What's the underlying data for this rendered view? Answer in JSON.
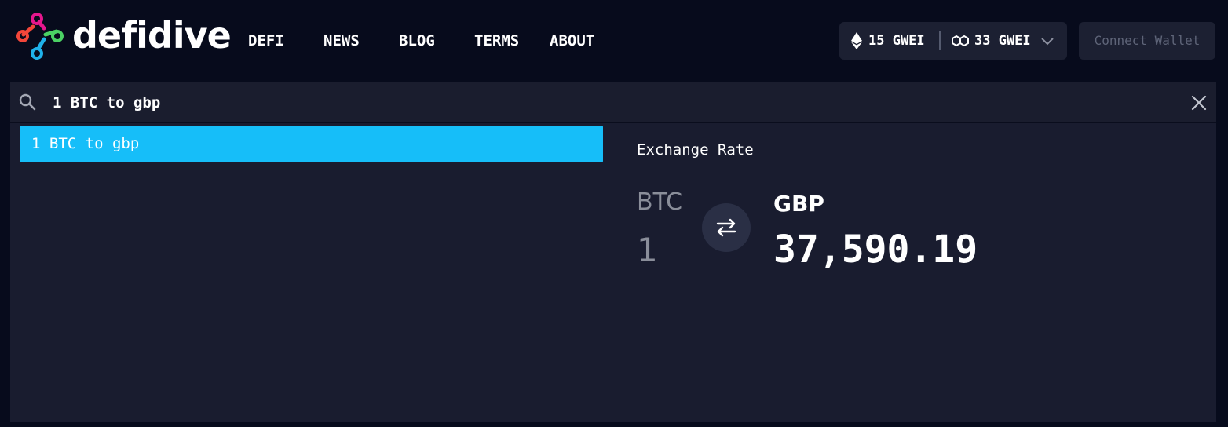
{
  "brand": {
    "name": "defidive"
  },
  "nav": {
    "items": [
      "DEFI",
      "NEWS",
      "BLOG",
      "TERMS",
      "ABOUT"
    ]
  },
  "gas": {
    "eth": "15 GWEI",
    "polygon": "33 GWEI"
  },
  "wallet": {
    "connect_label": "Connect Wallet"
  },
  "search": {
    "value": "1 BTC to gbp"
  },
  "results": [
    {
      "label": "1 BTC to gbp"
    }
  ],
  "exchange": {
    "title": "Exchange Rate",
    "from_code": "BTC",
    "from_amount": "1",
    "to_code": "GBP",
    "to_amount": "37,590.19"
  },
  "colors": {
    "background": "#070b1c",
    "panel": "#191c2f",
    "accent": "#16bef9",
    "logo_red": "#f2463a",
    "logo_pink": "#e5178d",
    "logo_green": "#4bd164",
    "logo_blue": "#1fb2ea"
  },
  "icons": [
    "logo-mark",
    "ethereum-icon",
    "polygon-icon",
    "chevron-down-icon",
    "search-icon",
    "close-icon",
    "swap-icon"
  ]
}
